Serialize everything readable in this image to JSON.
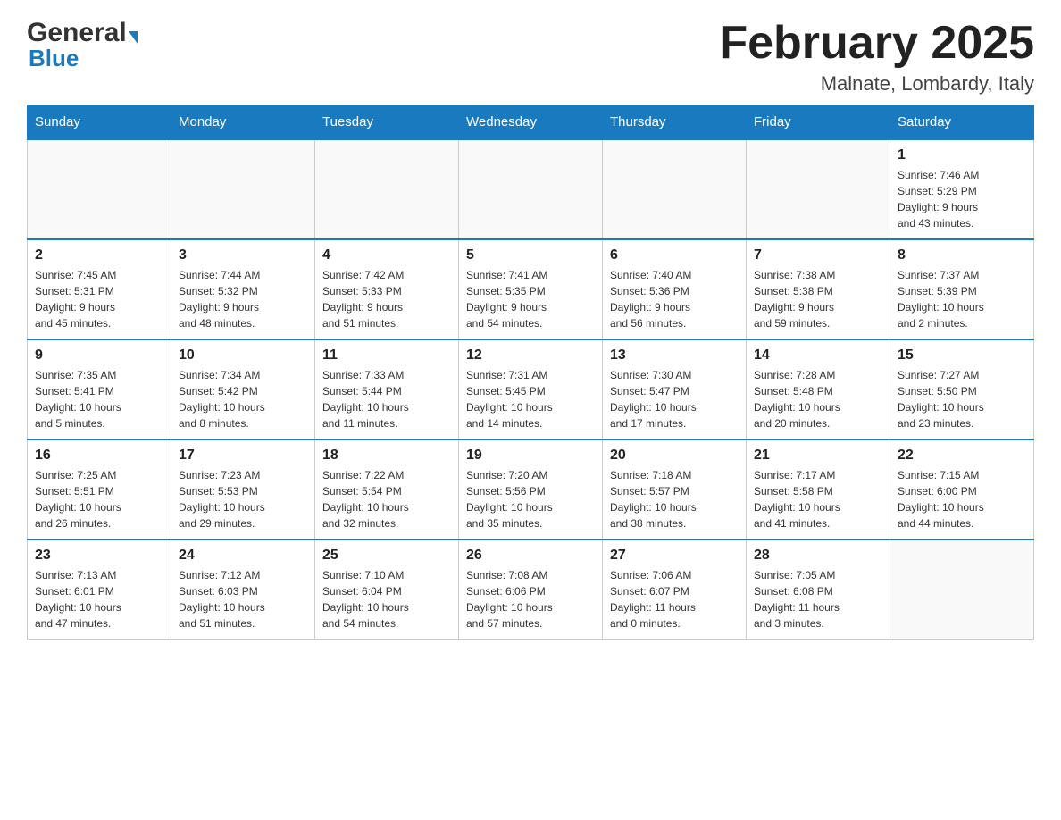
{
  "header": {
    "logo_general": "General",
    "logo_blue": "Blue",
    "month_title": "February 2025",
    "location": "Malnate, Lombardy, Italy"
  },
  "weekdays": [
    "Sunday",
    "Monday",
    "Tuesday",
    "Wednesday",
    "Thursday",
    "Friday",
    "Saturday"
  ],
  "weeks": [
    [
      {
        "day": "",
        "info": ""
      },
      {
        "day": "",
        "info": ""
      },
      {
        "day": "",
        "info": ""
      },
      {
        "day": "",
        "info": ""
      },
      {
        "day": "",
        "info": ""
      },
      {
        "day": "",
        "info": ""
      },
      {
        "day": "1",
        "info": "Sunrise: 7:46 AM\nSunset: 5:29 PM\nDaylight: 9 hours\nand 43 minutes."
      }
    ],
    [
      {
        "day": "2",
        "info": "Sunrise: 7:45 AM\nSunset: 5:31 PM\nDaylight: 9 hours\nand 45 minutes."
      },
      {
        "day": "3",
        "info": "Sunrise: 7:44 AM\nSunset: 5:32 PM\nDaylight: 9 hours\nand 48 minutes."
      },
      {
        "day": "4",
        "info": "Sunrise: 7:42 AM\nSunset: 5:33 PM\nDaylight: 9 hours\nand 51 minutes."
      },
      {
        "day": "5",
        "info": "Sunrise: 7:41 AM\nSunset: 5:35 PM\nDaylight: 9 hours\nand 54 minutes."
      },
      {
        "day": "6",
        "info": "Sunrise: 7:40 AM\nSunset: 5:36 PM\nDaylight: 9 hours\nand 56 minutes."
      },
      {
        "day": "7",
        "info": "Sunrise: 7:38 AM\nSunset: 5:38 PM\nDaylight: 9 hours\nand 59 minutes."
      },
      {
        "day": "8",
        "info": "Sunrise: 7:37 AM\nSunset: 5:39 PM\nDaylight: 10 hours\nand 2 minutes."
      }
    ],
    [
      {
        "day": "9",
        "info": "Sunrise: 7:35 AM\nSunset: 5:41 PM\nDaylight: 10 hours\nand 5 minutes."
      },
      {
        "day": "10",
        "info": "Sunrise: 7:34 AM\nSunset: 5:42 PM\nDaylight: 10 hours\nand 8 minutes."
      },
      {
        "day": "11",
        "info": "Sunrise: 7:33 AM\nSunset: 5:44 PM\nDaylight: 10 hours\nand 11 minutes."
      },
      {
        "day": "12",
        "info": "Sunrise: 7:31 AM\nSunset: 5:45 PM\nDaylight: 10 hours\nand 14 minutes."
      },
      {
        "day": "13",
        "info": "Sunrise: 7:30 AM\nSunset: 5:47 PM\nDaylight: 10 hours\nand 17 minutes."
      },
      {
        "day": "14",
        "info": "Sunrise: 7:28 AM\nSunset: 5:48 PM\nDaylight: 10 hours\nand 20 minutes."
      },
      {
        "day": "15",
        "info": "Sunrise: 7:27 AM\nSunset: 5:50 PM\nDaylight: 10 hours\nand 23 minutes."
      }
    ],
    [
      {
        "day": "16",
        "info": "Sunrise: 7:25 AM\nSunset: 5:51 PM\nDaylight: 10 hours\nand 26 minutes."
      },
      {
        "day": "17",
        "info": "Sunrise: 7:23 AM\nSunset: 5:53 PM\nDaylight: 10 hours\nand 29 minutes."
      },
      {
        "day": "18",
        "info": "Sunrise: 7:22 AM\nSunset: 5:54 PM\nDaylight: 10 hours\nand 32 minutes."
      },
      {
        "day": "19",
        "info": "Sunrise: 7:20 AM\nSunset: 5:56 PM\nDaylight: 10 hours\nand 35 minutes."
      },
      {
        "day": "20",
        "info": "Sunrise: 7:18 AM\nSunset: 5:57 PM\nDaylight: 10 hours\nand 38 minutes."
      },
      {
        "day": "21",
        "info": "Sunrise: 7:17 AM\nSunset: 5:58 PM\nDaylight: 10 hours\nand 41 minutes."
      },
      {
        "day": "22",
        "info": "Sunrise: 7:15 AM\nSunset: 6:00 PM\nDaylight: 10 hours\nand 44 minutes."
      }
    ],
    [
      {
        "day": "23",
        "info": "Sunrise: 7:13 AM\nSunset: 6:01 PM\nDaylight: 10 hours\nand 47 minutes."
      },
      {
        "day": "24",
        "info": "Sunrise: 7:12 AM\nSunset: 6:03 PM\nDaylight: 10 hours\nand 51 minutes."
      },
      {
        "day": "25",
        "info": "Sunrise: 7:10 AM\nSunset: 6:04 PM\nDaylight: 10 hours\nand 54 minutes."
      },
      {
        "day": "26",
        "info": "Sunrise: 7:08 AM\nSunset: 6:06 PM\nDaylight: 10 hours\nand 57 minutes."
      },
      {
        "day": "27",
        "info": "Sunrise: 7:06 AM\nSunset: 6:07 PM\nDaylight: 11 hours\nand 0 minutes."
      },
      {
        "day": "28",
        "info": "Sunrise: 7:05 AM\nSunset: 6:08 PM\nDaylight: 11 hours\nand 3 minutes."
      },
      {
        "day": "",
        "info": ""
      }
    ]
  ]
}
